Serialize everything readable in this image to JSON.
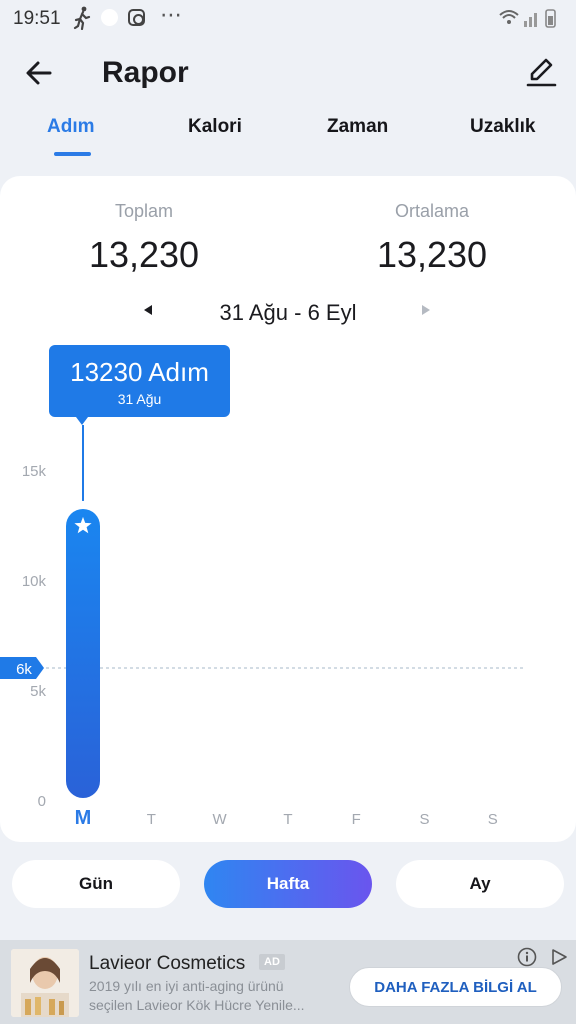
{
  "status_bar": {
    "time": "19:51",
    "more": "⋯"
  },
  "header": {
    "title": "Rapor"
  },
  "tabs": [
    {
      "label": "Adım",
      "active": true
    },
    {
      "label": "Kalori",
      "active": false
    },
    {
      "label": "Zaman",
      "active": false
    },
    {
      "label": "Uzaklık",
      "active": false
    }
  ],
  "summary": {
    "total_label": "Toplam",
    "total_value": "13,230",
    "average_label": "Ortalama",
    "average_value": "13,230"
  },
  "range": {
    "label": "31 Ağu - 6 Eyl"
  },
  "tooltip": {
    "main": "13230 Adım",
    "sub": "31 Ağu"
  },
  "chart_data": {
    "type": "bar",
    "categories": [
      "M",
      "T",
      "W",
      "T",
      "F",
      "S",
      "S"
    ],
    "values": [
      13230,
      0,
      0,
      0,
      0,
      0,
      0
    ],
    "selected_index": 0,
    "y_ticks": [
      "0",
      "5k",
      "10k",
      "15k"
    ],
    "y_tick_values": [
      0,
      5000,
      10000,
      15000
    ],
    "ylim": [
      0,
      15000
    ],
    "average_marker": {
      "label": "6k",
      "value": 6000
    },
    "bar_color": "#1f7ae7",
    "accent": "#2b7be6"
  },
  "periods": [
    {
      "label": "Gün",
      "active": false
    },
    {
      "label": "Hafta",
      "active": true
    },
    {
      "label": "Ay",
      "active": false
    }
  ],
  "ad": {
    "title": "Lavieor Cosmetics",
    "badge": "AD",
    "line1": "2019 yılı en iyi anti-aging ürünü",
    "line2": "seçilen Lavieor Kök Hücre Yenile...",
    "cta": "DAHA FAZLA BİLGİ AL"
  }
}
